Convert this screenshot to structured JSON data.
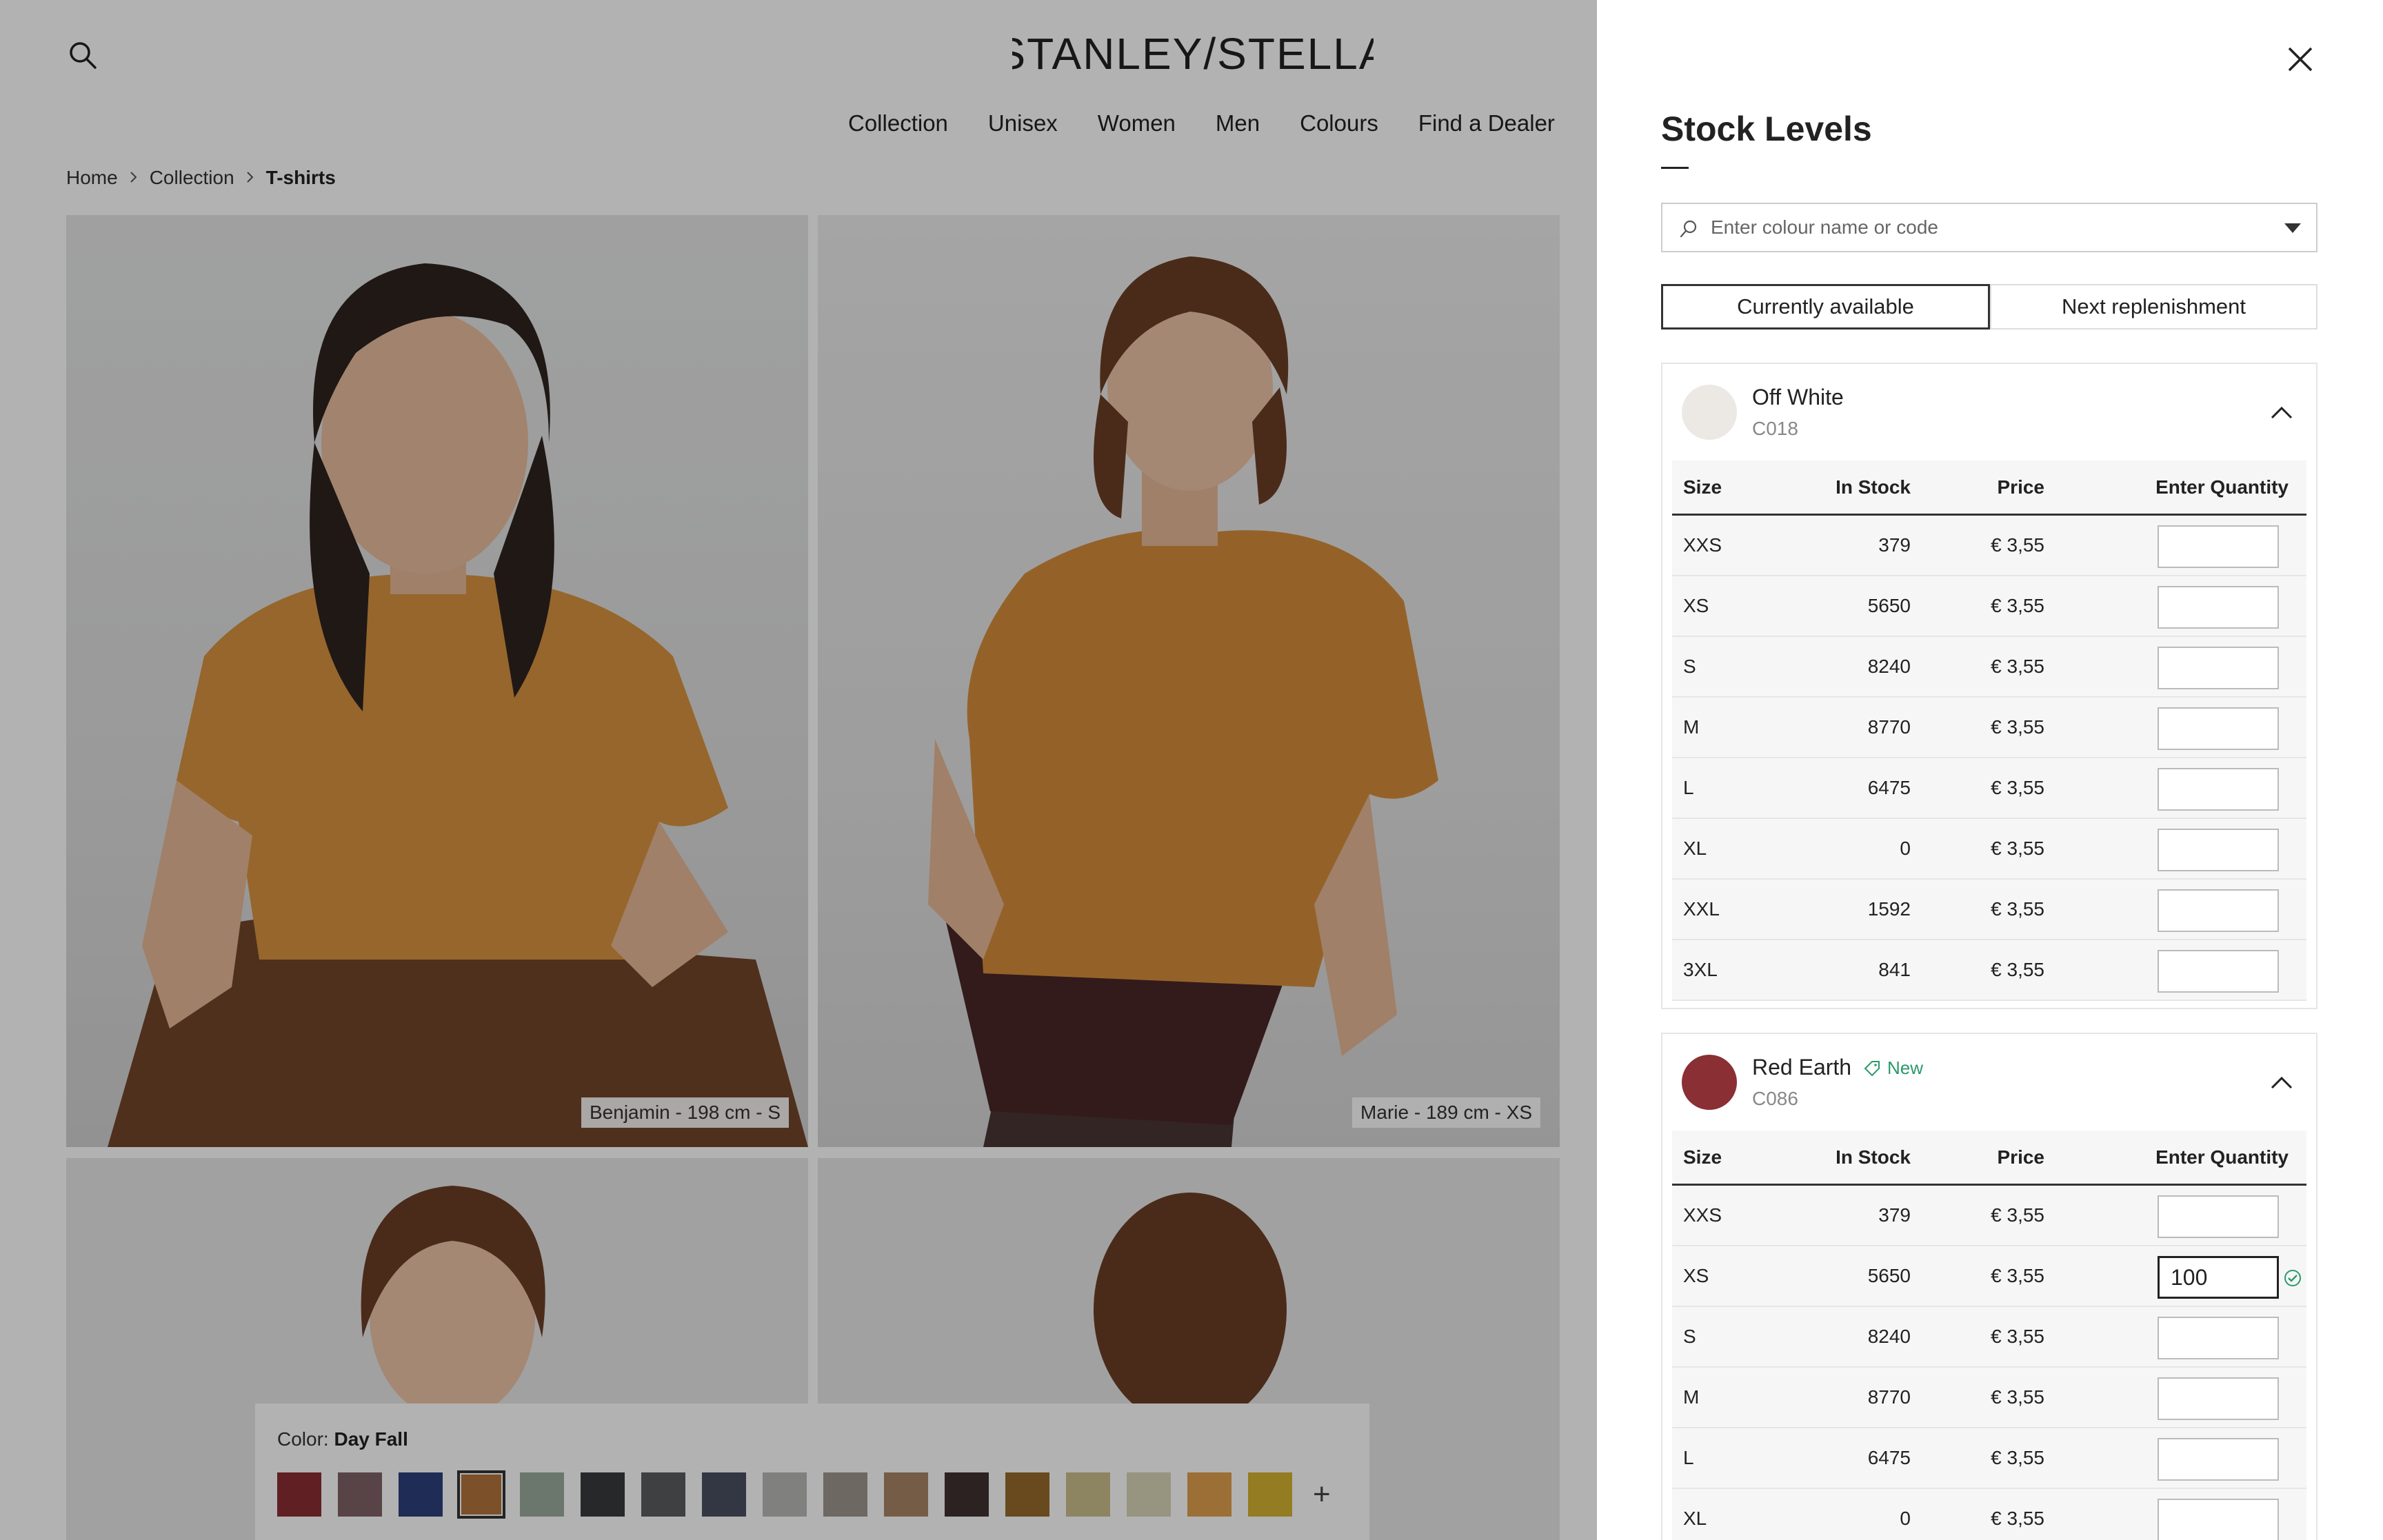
{
  "header": {
    "brand": "STANLEY/STELLA",
    "nav": [
      "Collection",
      "Unisex",
      "Women",
      "Men",
      "Colours",
      "Find a Dealer"
    ]
  },
  "breadcrumb": {
    "home": "Home",
    "collection": "Collection",
    "current": "T-shirts"
  },
  "photos": {
    "caption_1": "Benjamin - 198 cm - S",
    "caption_2": "Marie - 189 cm - XS"
  },
  "color_picker": {
    "label": "Color:",
    "selected": "Day Fall",
    "swatches": [
      "#8a2f33",
      "#7e6265",
      "#2d3f7c",
      "#b2733a",
      "#9aab9d",
      "#383a3d",
      "#5a5c5e",
      "#4a4f61",
      "#b8b8b6",
      "#9c958c",
      "#a78466",
      "#3e3130",
      "#956a2b",
      "#cbbd8d",
      "#d9d5b8",
      "#dfa04d",
      "#d4b232"
    ],
    "selected_index": 3,
    "plus": "+"
  },
  "panel": {
    "title": "Stock Levels",
    "search_placeholder": "Enter colour name or code",
    "tabs": [
      "Currently available",
      "Next replenishment"
    ],
    "active_tab": 0,
    "columns": {
      "size": "Size",
      "in_stock": "In Stock",
      "price": "Price",
      "quantity": "Enter Quantity"
    },
    "colours": [
      {
        "name": "Off White",
        "code": "C018",
        "swatch": "#ece8e4",
        "rows": [
          {
            "size": "XXS",
            "stock": "379",
            "price": "€ 3,55",
            "qty": ""
          },
          {
            "size": "XS",
            "stock": "5650",
            "price": "€ 3,55",
            "qty": ""
          },
          {
            "size": "S",
            "stock": "8240",
            "price": "€ 3,55",
            "qty": ""
          },
          {
            "size": "M",
            "stock": "8770",
            "price": "€ 3,55",
            "qty": ""
          },
          {
            "size": "L",
            "stock": "6475",
            "price": "€ 3,55",
            "qty": ""
          },
          {
            "size": "XL",
            "stock": "0",
            "price": "€ 3,55",
            "qty": ""
          },
          {
            "size": "XXL",
            "stock": "1592",
            "price": "€ 3,55",
            "qty": ""
          },
          {
            "size": "3XL",
            "stock": "841",
            "price": "€ 3,55",
            "qty": ""
          }
        ]
      },
      {
        "name": "Red Earth",
        "code": "C086",
        "badge": "New",
        "swatch": "#8a2f33",
        "rows": [
          {
            "size": "XXS",
            "stock": "379",
            "price": "€ 3,55",
            "qty": ""
          },
          {
            "size": "XS",
            "stock": "5650",
            "price": "€ 3,55",
            "qty": "100"
          },
          {
            "size": "S",
            "stock": "8240",
            "price": "€ 3,55",
            "qty": ""
          },
          {
            "size": "M",
            "stock": "8770",
            "price": "€ 3,55",
            "qty": ""
          },
          {
            "size": "L",
            "stock": "6475",
            "price": "€ 3,55",
            "qty": ""
          },
          {
            "size": "XL",
            "stock": "0",
            "price": "€ 3,55",
            "qty": ""
          }
        ]
      }
    ]
  }
}
